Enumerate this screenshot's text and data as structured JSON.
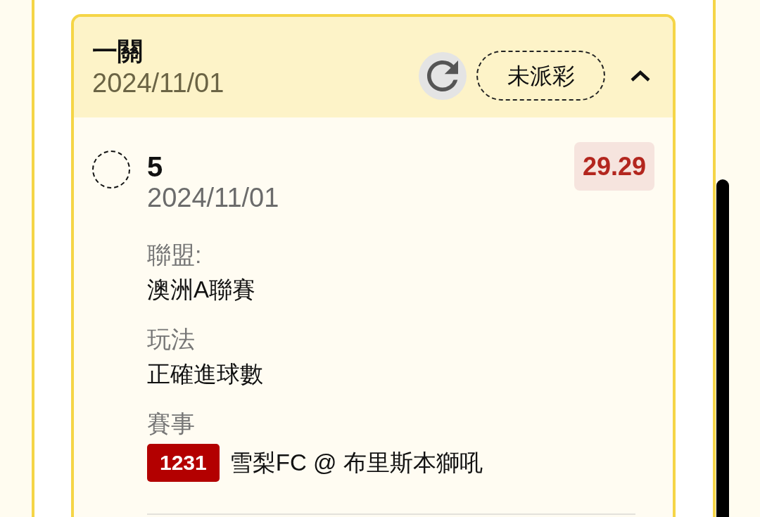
{
  "card": {
    "title": "一關",
    "date": "2024/11/01",
    "status": "未派彩",
    "expanded": true,
    "selections": [
      {
        "selected": false,
        "pick": "5",
        "date": "2024/11/01",
        "odds": "29.29",
        "fields": [
          {
            "kind": "text",
            "label": "聯盟:",
            "value": "澳洲A聯賽"
          },
          {
            "kind": "text",
            "label": "玩法",
            "value": "正確進球數"
          },
          {
            "kind": "match",
            "label": "賽事",
            "match_number": "1231",
            "value": "雪梨FC @ 布里斯本獅吼"
          }
        ]
      }
    ]
  }
}
